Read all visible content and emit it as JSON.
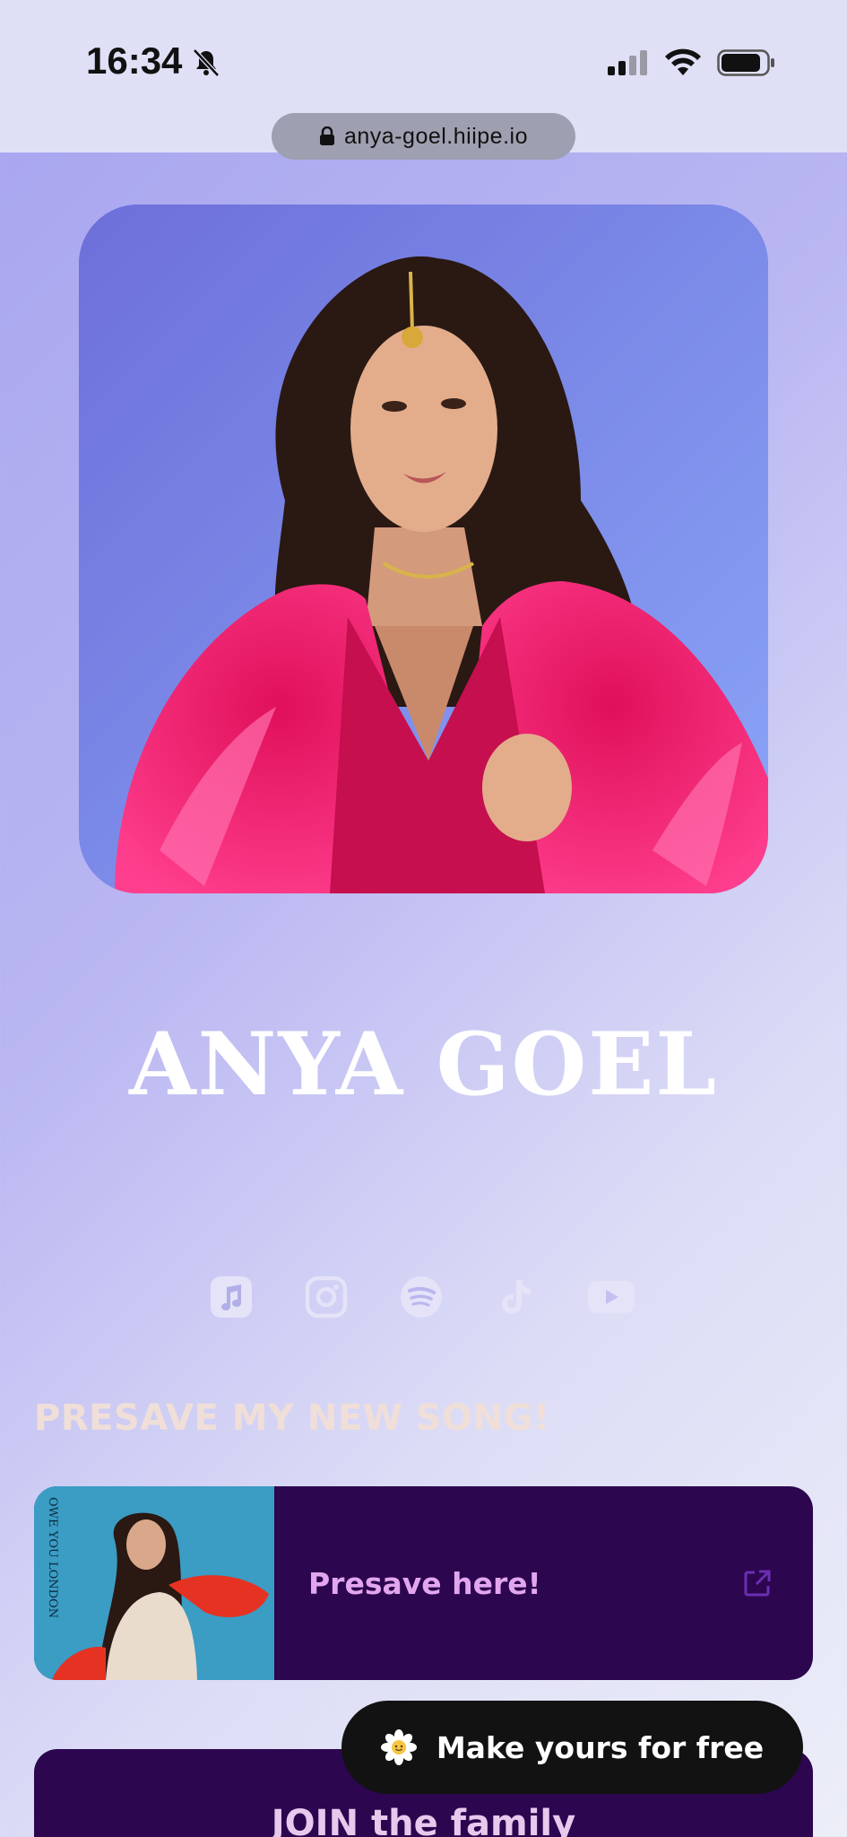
{
  "status_bar": {
    "time": "16:34"
  },
  "browser": {
    "url": "anya-goel.hiipe.io"
  },
  "profile": {
    "name": "ANYA GOEL"
  },
  "social_links": [
    {
      "icon": "apple-music-icon"
    },
    {
      "icon": "instagram-icon"
    },
    {
      "icon": "spotify-icon"
    },
    {
      "icon": "tiktok-icon"
    },
    {
      "icon": "youtube-icon"
    }
  ],
  "presave_section": {
    "title": "PRESAVE MY NEW SONG!",
    "card_label": "Presave here!",
    "cover_text": "OWE YOU LONDON"
  },
  "join_section": {
    "label": "JOIN the family"
  },
  "cta": {
    "label": "Make yours for free"
  },
  "colors": {
    "card_bg": "#2c064f",
    "accent_pink": "#e2a6ee",
    "section_title": "#f0dfd8"
  }
}
